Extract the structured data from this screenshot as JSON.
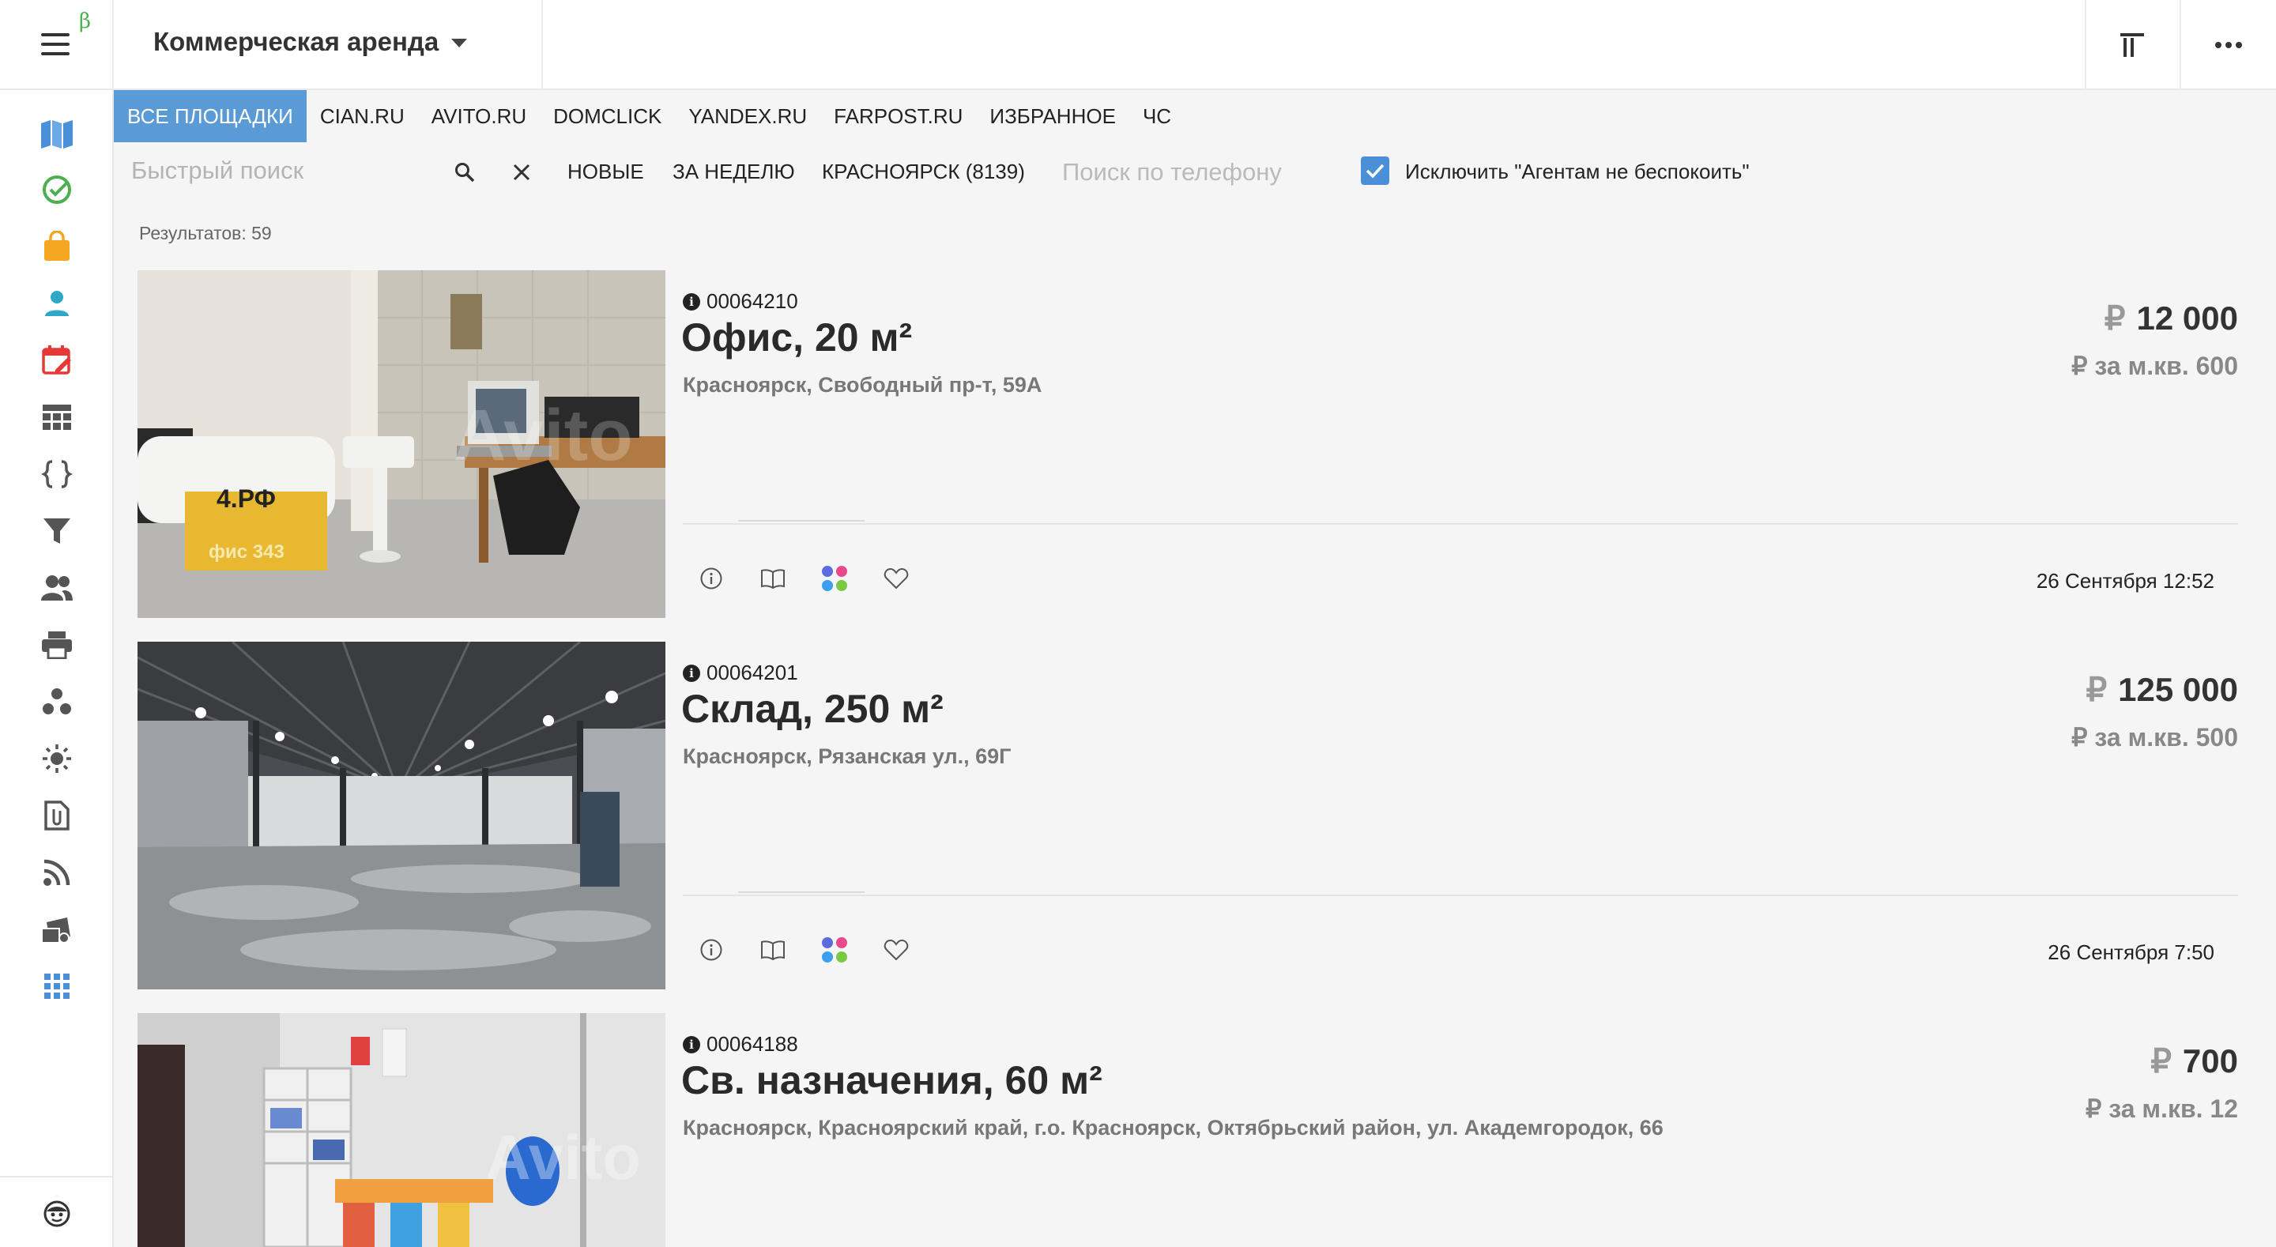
{
  "app": {
    "beta_mark": "β",
    "title": "Коммерческая аренда"
  },
  "colors": {
    "accent": "#5b9bd5",
    "checkbox": "#4a90d9",
    "nav_blue": "#4a90d9",
    "nav_green": "#4caf50",
    "nav_orange": "#f5a623",
    "nav_red": "#e53935"
  },
  "sidebar": {
    "items": [
      {
        "icon": "map-book-icon"
      },
      {
        "icon": "check-circle-icon"
      },
      {
        "icon": "shopping-bag-icon"
      },
      {
        "icon": "person-icon"
      },
      {
        "icon": "calendar-edit-icon"
      },
      {
        "icon": "table-icon"
      },
      {
        "icon": "code-braces-icon"
      },
      {
        "icon": "filter-icon"
      },
      {
        "icon": "people-icon"
      },
      {
        "icon": "printer-icon"
      },
      {
        "icon": "dots-cluster-icon"
      },
      {
        "icon": "sun-icon"
      },
      {
        "icon": "attachment-file-icon"
      },
      {
        "icon": "rss-icon"
      },
      {
        "icon": "certificate-icon"
      },
      {
        "icon": "apps-grid-icon"
      }
    ],
    "bottom_icon": "smiley-icon"
  },
  "tabs": [
    {
      "label": "ВСЕ ПЛОЩАДКИ",
      "active": true
    },
    {
      "label": "CIAN.RU"
    },
    {
      "label": "AVITO.RU"
    },
    {
      "label": "DOMCLICK"
    },
    {
      "label": "YANDEX.RU"
    },
    {
      "label": "FARPOST.RU"
    },
    {
      "label": "ИЗБРАННОЕ"
    },
    {
      "label": "ЧС"
    }
  ],
  "filters": {
    "quick_search_placeholder": "Быстрый поиск",
    "quick_search_value": "",
    "chips": [
      "НОВЫЕ",
      "ЗА НЕДЕЛЮ",
      "КРАСНОЯРСК (8139)"
    ],
    "phone_search_placeholder": "Поиск по телефону",
    "exclude_agents_label": "Исключить \"Агентам не беспокоить\"",
    "exclude_agents_checked": true
  },
  "results_label": "Результатов: 59",
  "listings": [
    {
      "id": "00064210",
      "title": "Офис, 20 м²",
      "address": "Красноярск, Свободный пр-т, 59А",
      "price": "12 000",
      "price_per_m2": "за м.кв. 600",
      "currency": "₽",
      "date": "26 Сентября 12:52"
    },
    {
      "id": "00064201",
      "title": "Склад, 250 м²",
      "address": "Красноярск, Рязанская ул., 69Г",
      "price": "125 000",
      "price_per_m2": "за м.кв. 500",
      "currency": "₽",
      "date": "26 Сентября 7:50"
    },
    {
      "id": "00064188",
      "title": "Св. назначения, 60 м²",
      "address": "Красноярск, Красноярский край, г.о. Красноярск, Октябрьский район, ул. Академгородок, 66",
      "price": "700",
      "price_per_m2": "за м.кв. 12",
      "currency": "₽",
      "date": ""
    }
  ],
  "photo_overlays": {
    "listing0_sign": "4.РФ",
    "listing0_sign2": "фис 343",
    "listing0_watermark": "Avito",
    "listing2_watermark": "Avito"
  }
}
